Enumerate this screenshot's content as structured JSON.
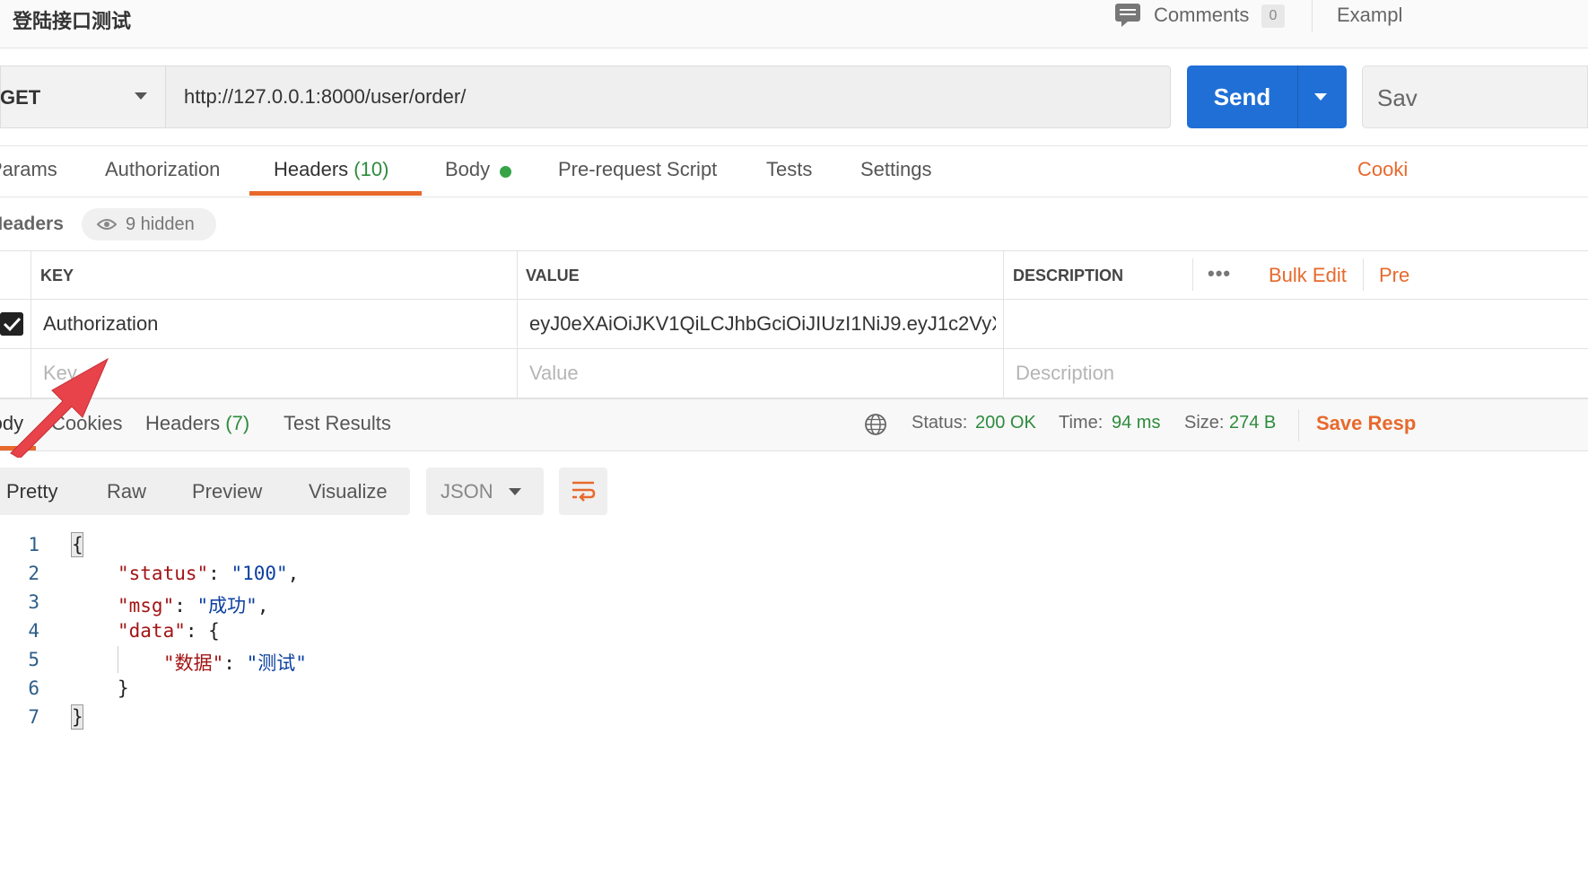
{
  "tab": {
    "title": "登陆接口测试"
  },
  "topbar": {
    "comments_label": "Comments",
    "comments_count": "0",
    "examples_label": "Exampl"
  },
  "request": {
    "method": "GET",
    "url": "http://127.0.0.1:8000/user/order/",
    "send_label": "Send",
    "save_label": "Sav"
  },
  "request_tabs": {
    "params": "Params",
    "authorization": "Authorization",
    "headers": "Headers",
    "headers_count": "(10)",
    "body": "Body",
    "pre_request": "Pre-request Script",
    "tests": "Tests",
    "settings": "Settings",
    "cookies": "Cooki"
  },
  "headers_section": {
    "label": "Headers",
    "hidden": "9 hidden"
  },
  "headers_table": {
    "columns": {
      "key": "KEY",
      "value": "VALUE",
      "description": "DESCRIPTION"
    },
    "more": "•••",
    "bulk_edit": "Bulk Edit",
    "presets": "Pre",
    "rows": [
      {
        "checked": true,
        "key": "Authorization",
        "value": "eyJ0eXAiOiJKV1QiLCJhbGciOiJIUzI1NiJ9.eyJ1c2VyX2l ...",
        "description": ""
      }
    ],
    "placeholders": {
      "key": "Key",
      "value": "Value",
      "description": "Description"
    }
  },
  "response_tabs": {
    "body": "Body",
    "cookies": "Cookies",
    "headers": "Headers",
    "headers_count": "(7)",
    "test_results": "Test Results"
  },
  "response_status": {
    "status_label": "Status:",
    "status_value": "200 OK",
    "time_label": "Time:",
    "time_value": "94 ms",
    "size_label": "Size:",
    "size_value": "274 B",
    "save_response": "Save Resp"
  },
  "format": {
    "pretty": "Pretty",
    "raw": "Raw",
    "preview": "Preview",
    "visualize": "Visualize",
    "language": "JSON"
  },
  "code": {
    "line_numbers": [
      "1",
      "2",
      "3",
      "4",
      "5",
      "6",
      "7"
    ],
    "open_brace": "{",
    "status_key": "\"status\"",
    "status_value": "\"100\"",
    "msg_key": "\"msg\"",
    "msg_value": "\"成功\"",
    "data_key": "\"data\"",
    "inner_key": "\"数据\"",
    "inner_value": "\"测试\"",
    "inner_close": "}",
    "close_brace": "}"
  },
  "colors": {
    "accent": "#e8692c",
    "send_blue": "#1f6fd6",
    "success_green": "#2e8b3d",
    "annotation_arrow": "#e8434a"
  }
}
